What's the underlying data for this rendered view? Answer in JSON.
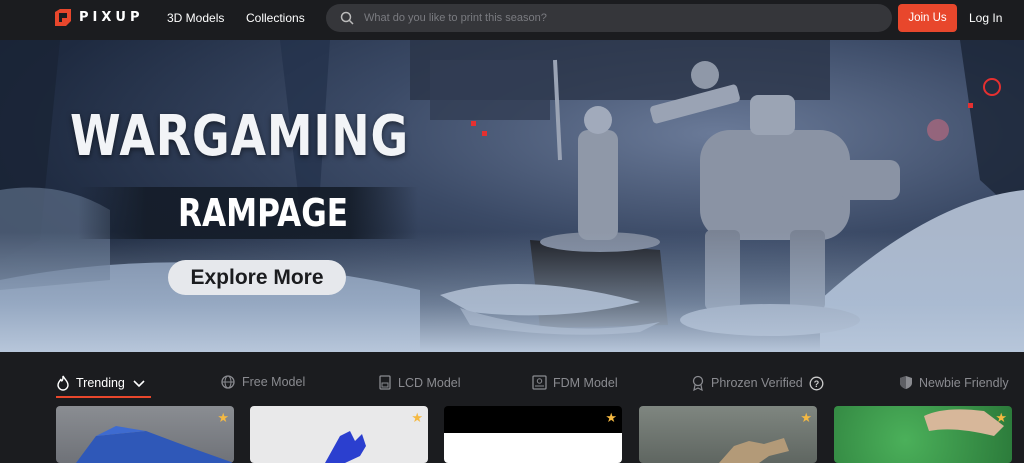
{
  "brand": {
    "name": "PIXUP"
  },
  "nav": {
    "models": "3D Models",
    "collections": "Collections"
  },
  "search": {
    "placeholder": "What do you like to print this season?"
  },
  "auth": {
    "join": "Join Us",
    "login": "Log In"
  },
  "banner": {
    "title_line1": "WARGAMING",
    "title_line2": "RAMPAGE",
    "cta": "Explore More"
  },
  "categories": [
    {
      "label": "Trending",
      "icon": "flame-icon",
      "active": true
    },
    {
      "label": "Free Model",
      "icon": "globe-icon"
    },
    {
      "label": "LCD Model",
      "icon": "printer-icon"
    },
    {
      "label": "FDM Model",
      "icon": "box-icon"
    },
    {
      "label": "Phrozen Verified",
      "icon": "verified-icon"
    },
    {
      "label": "Newbie Friendly",
      "icon": "shield-icon"
    }
  ],
  "colors": {
    "accent": "#e8472c",
    "background": "#1b1c1f",
    "search_bg": "#35363a",
    "star": "#f5b942"
  }
}
